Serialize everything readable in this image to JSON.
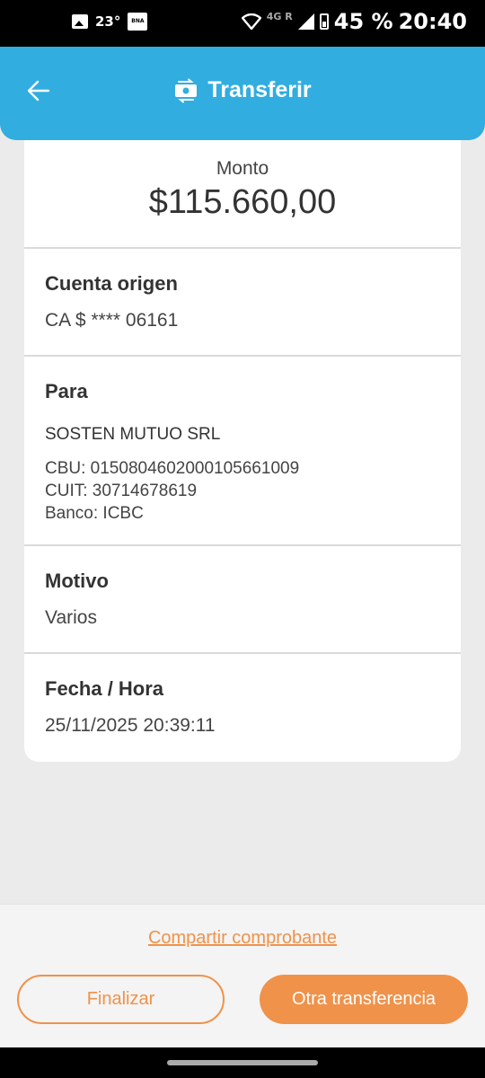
{
  "status_bar": {
    "temperature": "23°",
    "bna_badge": "BNA",
    "network": "4G",
    "roaming": "R",
    "battery": "45 %",
    "time": "20:40"
  },
  "header": {
    "title": "Transferir",
    "color": "#31ade0"
  },
  "receipt": {
    "amount_label": "Monto",
    "amount_value": "$115.660,00",
    "origin_label": "Cuenta origen",
    "origin_value": "CA $ **** 06161",
    "to_label": "Para",
    "recipient_name": "SOSTEN MUTUO SRL",
    "cbu": "CBU:  0150804602000105661009",
    "cuit": "CUIT:  30714678619",
    "bank": "Banco:  ICBC",
    "reason_label": "Motivo",
    "reason_value": "Varios",
    "datetime_label": "Fecha / Hora",
    "datetime_value": "25/11/2025 20:39:11"
  },
  "actions": {
    "share_link": "Compartir comprobante",
    "finish_button": "Finalizar",
    "another_button": "Otra transferencia",
    "accent_color": "#f0924a"
  },
  "icons": {
    "back": "arrow-left-icon",
    "title": "money-transfer-icon",
    "wifi": "wifi-icon",
    "signal": "signal-icon",
    "battery": "battery-icon",
    "gallery": "image-icon"
  }
}
